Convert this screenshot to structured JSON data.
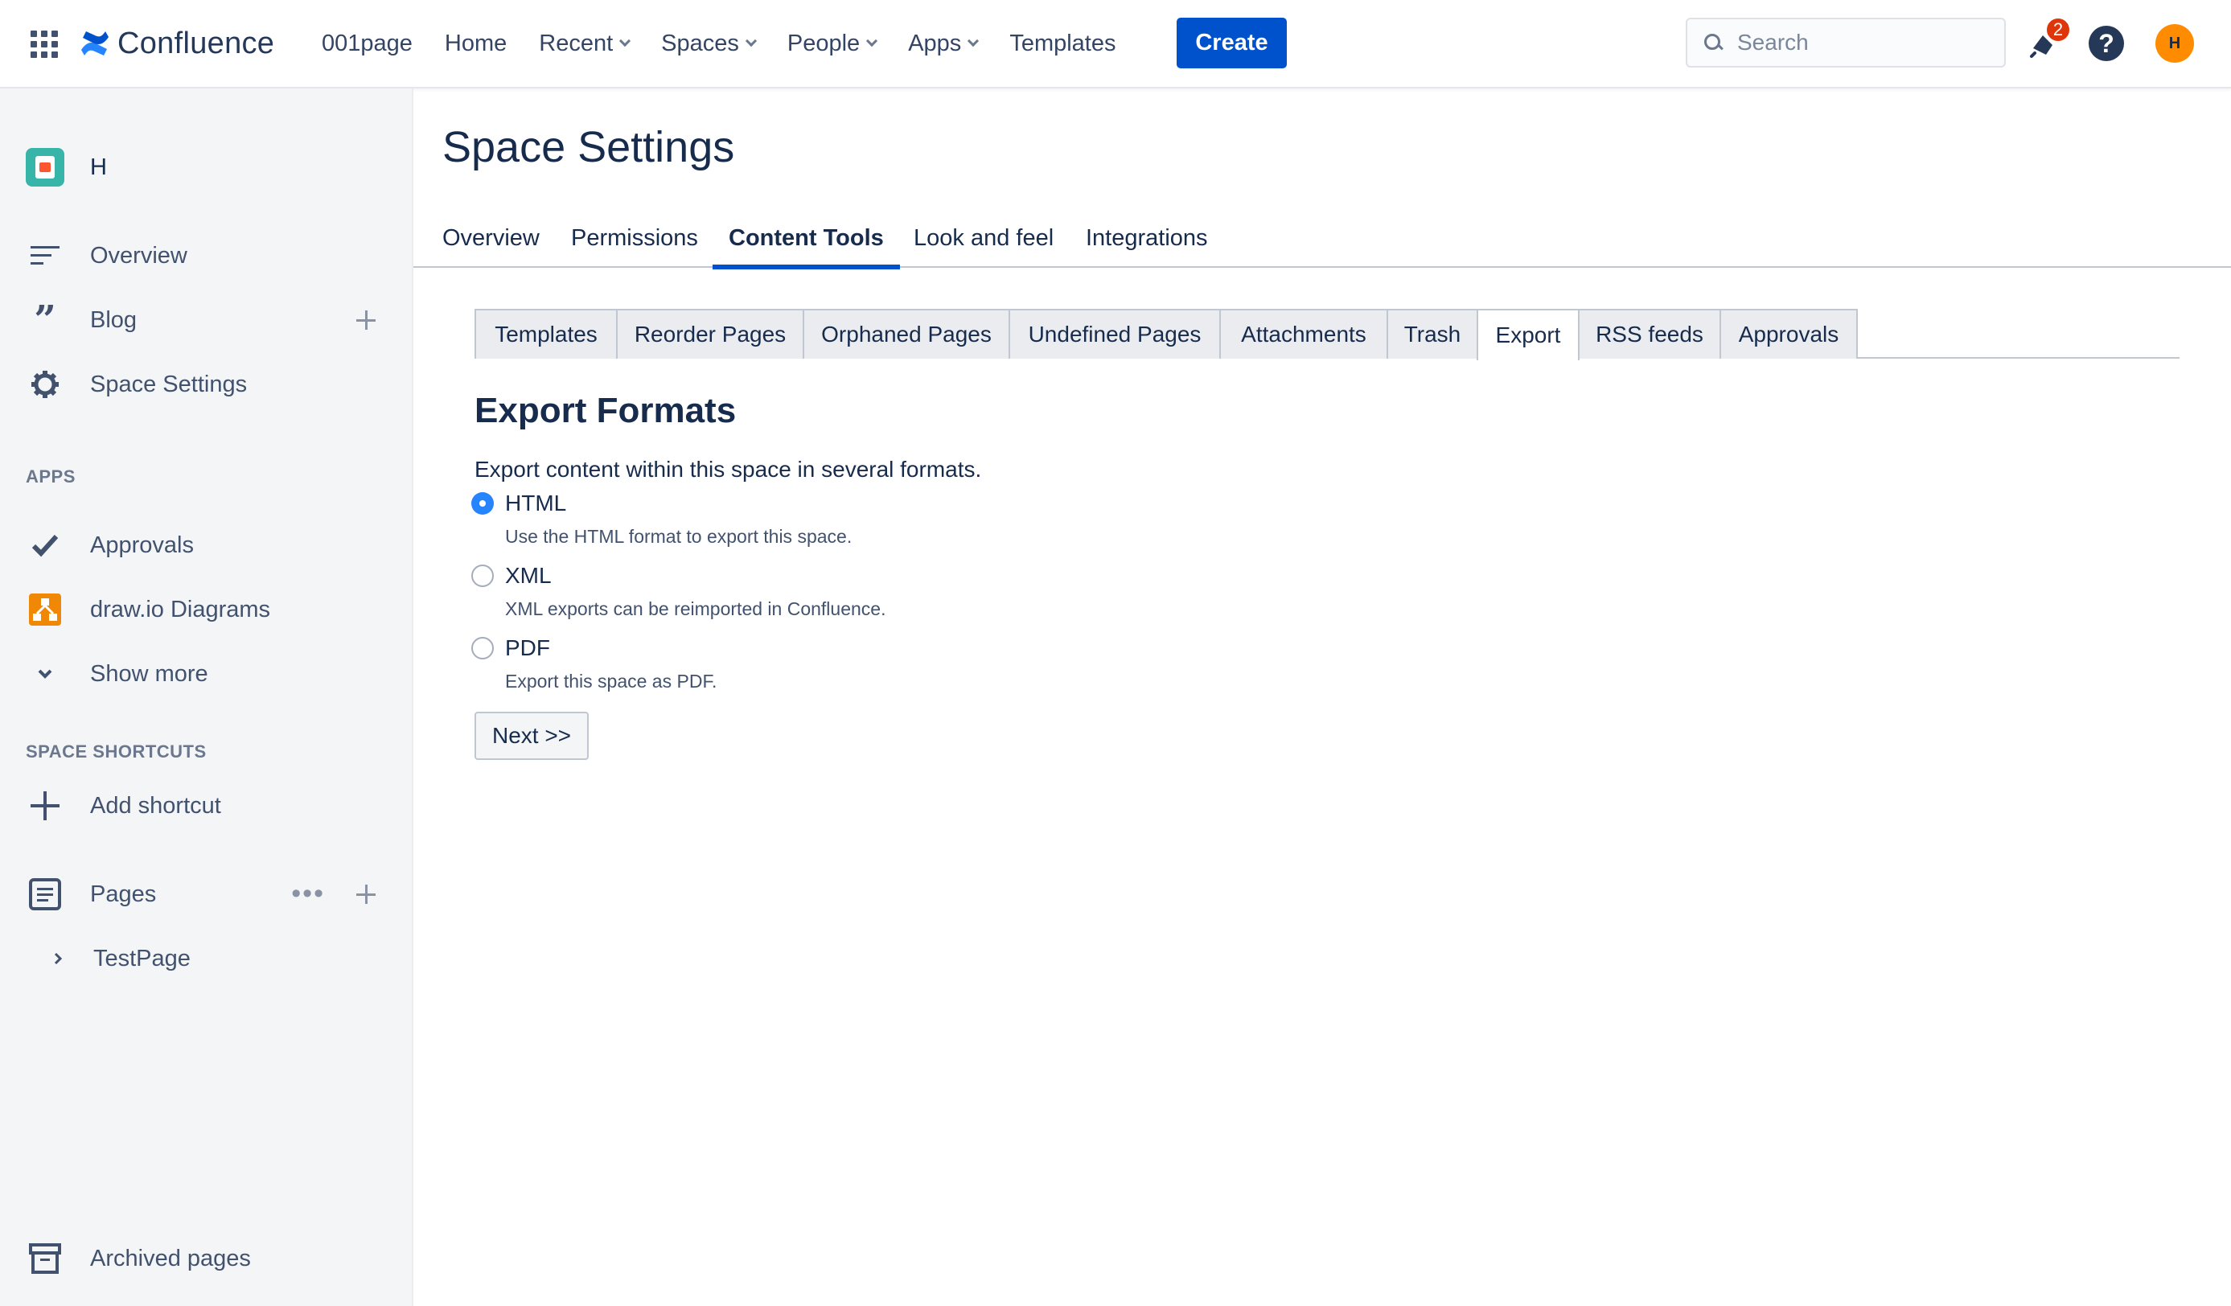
{
  "topnav": {
    "brand": "Confluence",
    "items": [
      {
        "label": "001page",
        "dropdown": false
      },
      {
        "label": "Home",
        "dropdown": false
      },
      {
        "label": "Recent",
        "dropdown": true
      },
      {
        "label": "Spaces",
        "dropdown": true
      },
      {
        "label": "People",
        "dropdown": true
      },
      {
        "label": "Apps",
        "dropdown": true
      },
      {
        "label": "Templates",
        "dropdown": false
      }
    ],
    "create_label": "Create",
    "search_placeholder": "Search",
    "notification_count": "2",
    "help_glyph": "?",
    "avatar_initial": "H",
    "colors": {
      "create": "#0052cc",
      "badge": "#de350b",
      "avatar": "#ff8b00"
    }
  },
  "sidebar": {
    "space_name": "H",
    "items": [
      {
        "label": "Overview",
        "icon": "overview-icon"
      },
      {
        "label": "Blog",
        "icon": "quote-icon"
      },
      {
        "label": "Space Settings",
        "icon": "gear-icon"
      }
    ],
    "apps_heading": "APPS",
    "apps": [
      {
        "label": "Approvals",
        "icon": "checkmark-icon"
      },
      {
        "label": "draw.io Diagrams",
        "icon": "drawio-icon"
      },
      {
        "label": "Show more",
        "icon": "chevron-down-icon"
      }
    ],
    "shortcuts_heading": "SPACE SHORTCUTS",
    "add_shortcut": "Add shortcut",
    "pages_label": "Pages",
    "tree": [
      {
        "label": "TestPage"
      }
    ],
    "archived_label": "Archived pages"
  },
  "main": {
    "title": "Space Settings",
    "tabs": [
      "Overview",
      "Permissions",
      "Content Tools",
      "Look and feel",
      "Integrations"
    ],
    "active_tab": "Content Tools",
    "subtabs": [
      "Templates",
      "Reorder Pages",
      "Orphaned Pages",
      "Undefined Pages",
      "Attachments",
      "Trash",
      "Export",
      "RSS feeds",
      "Approvals"
    ],
    "active_subtab": "Export",
    "section_title": "Export Formats",
    "intro": "Export content within this space in several formats.",
    "options": [
      {
        "label": "HTML",
        "desc": "Use the HTML format to export this space.",
        "checked": true
      },
      {
        "label": "XML",
        "desc": "XML exports can be reimported in Confluence.",
        "checked": false
      },
      {
        "label": "PDF",
        "desc": "Export this space as PDF.",
        "checked": false
      }
    ],
    "next_label": "Next >>"
  }
}
